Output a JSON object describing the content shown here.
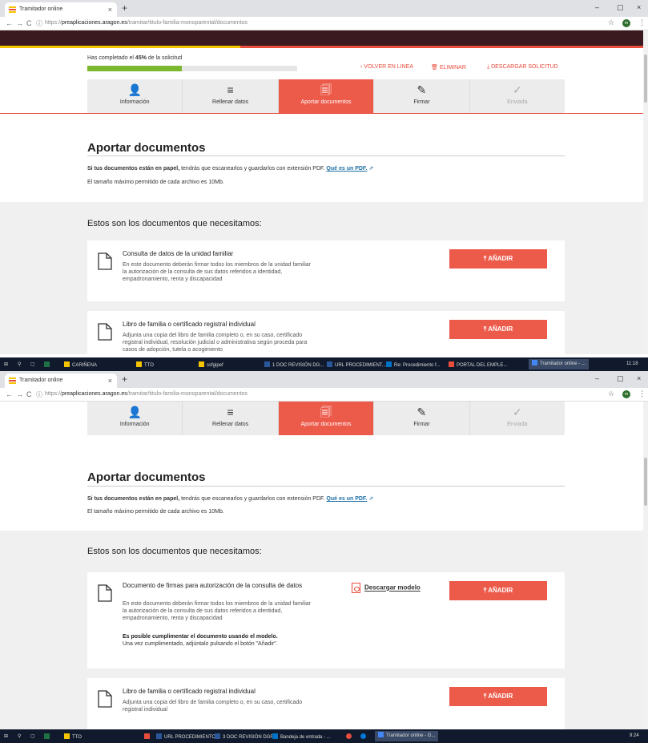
{
  "browser": {
    "tab_title": "Tramitador online",
    "tab_close": "×",
    "new_tab": "+",
    "url_scheme": "https://",
    "url_domain": "preaplicaciones.aragon.es",
    "url_path": "/tramitar/titulo-familia-monoparental/documentos",
    "back": "←",
    "forward": "→",
    "reload": "C",
    "info": "ⓘ",
    "star": "☆",
    "profile": "m",
    "menu": "⋮",
    "minimize": "–",
    "maximize": "▢",
    "close": "×"
  },
  "progress": {
    "prefix": "Has completado el ",
    "percent": "45%",
    "suffix": " de la solicitud",
    "fraction": 0.45
  },
  "header_actions": {
    "back": "VOLVER EN LINEA",
    "delete": "ELIMINAR",
    "download": "DESCARGAR SOLICITUD"
  },
  "steps": [
    {
      "label": "Información",
      "icon": "user-icon",
      "glyph": "👤"
    },
    {
      "label": "Rellenar datos",
      "icon": "list-icon",
      "glyph": "≡"
    },
    {
      "label": "Aportar documentos",
      "icon": "documents-icon",
      "glyph": "🗐"
    },
    {
      "label": "Firmar",
      "icon": "pen-icon",
      "glyph": "✎"
    },
    {
      "label": "Enviada",
      "icon": "check-icon",
      "glyph": "✓"
    }
  ],
  "section": {
    "title": "Aportar documentos",
    "info_bold": "Si tus documentos están en papel,",
    "info_text": " tendrás que escanearlos y guardarlos con extensión PDF. ",
    "info_link": "Qué es un PDF.",
    "info_max": "El tamaño máximo permitido de cada archivo es 10Mb."
  },
  "docs_heading": "Estos son los documentos que necesitamos:",
  "add_label": "AÑADIR",
  "shot1_cards": [
    {
      "title": "Consulta de datos de la unidad familiar",
      "desc": "En este documento deberán firmar todos los miembros de la unidad familiar la autorización de la consulta de sus datos referidos a identidad, empadronamiento, renta y discapacidad"
    },
    {
      "title": "Libro de familia o certificado registral individual",
      "desc": "Adjunta una copia del libro de familia completo o, en su caso, certificado registral individual, resolución judicial o administrativa según proceda para casos de adopción, tutela o acogimiento"
    }
  ],
  "shot2_cards": [
    {
      "title": "Documento de firmas para autorización de la consulta de datos",
      "desc": "En este documento deberán firmar todos los miembros de la unidad familiar la autorización de la consulta de sus datos referidos a identidad, empadronamiento, renta y discapacidad",
      "note_bold": "Es posible cumplimentar el documento usando el modelo.",
      "note": "Una vez cumplimentado, adjúntalo pulsando el botón \"Añadir\".",
      "download": "Descargar modelo"
    },
    {
      "title": "Libro de familia o certificado registral individual",
      "desc": "Adjunta una copia del libro de familia completo o, en su caso, certificado registral individual"
    }
  ],
  "taskbar1": {
    "items": [
      "CARIÑENA",
      "TTO",
      "ssfgipef",
      "1 DOC REVISIÓN DG...",
      "URL PROCEDIMIENT...",
      "Re: Procedimiento f...",
      "PORTAL DEL EMPLE...",
      "Tramitador online - ..."
    ],
    "time": "11:18"
  },
  "taskbar2": {
    "items": [
      "TTO",
      "URL PROCEDIMIENTO...",
      "3 DOC REVISIÓN DGF...",
      "Bandeja de entrada - ...",
      "Tramitador online - G..."
    ],
    "time": "9:24"
  },
  "colors": {
    "accent": "#ec5a4a",
    "progress": "#7cb82f",
    "link": "#1d6fa5"
  }
}
